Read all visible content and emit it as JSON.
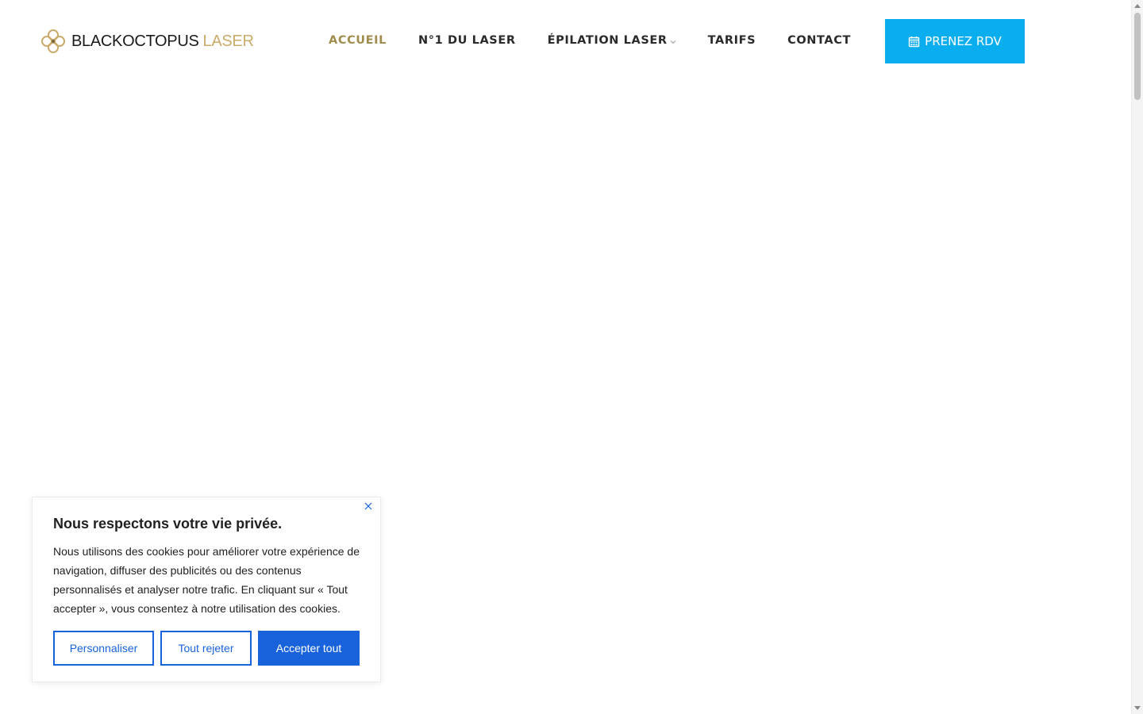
{
  "header": {
    "logo": {
      "text_dark": "BLACKOCTOPUS",
      "text_accent": "LASER",
      "accent_color": "#c9ab6a"
    },
    "nav": [
      {
        "label": "ACCUEIL",
        "active": true
      },
      {
        "label": "N°1 DU LASER",
        "active": false
      },
      {
        "label": "ÉPILATION LASER",
        "active": false,
        "has_dropdown": true
      },
      {
        "label": "TARIFS",
        "active": false
      },
      {
        "label": "CONTACT",
        "active": false
      }
    ],
    "active_color": "#a08c4c",
    "cta": {
      "label": "PRENEZ RDV",
      "icon": "calendar-icon",
      "color": "#0aaeee"
    }
  },
  "cookie_banner": {
    "title": "Nous respectons votre vie privée.",
    "text": "Nous utilisons des cookies pour améliorer votre expérience de navigation, diffuser des publicités ou des contenus personnalisés et analyser notre trafic. En cliquant sur « Tout accepter », vous consentez à notre utilisation des cookies.",
    "buttons": {
      "customize": "Personnaliser",
      "reject": "Tout rejeter",
      "accept": "Accepter tout"
    },
    "close_icon": "close-icon",
    "accent_color": "#1863dc"
  }
}
